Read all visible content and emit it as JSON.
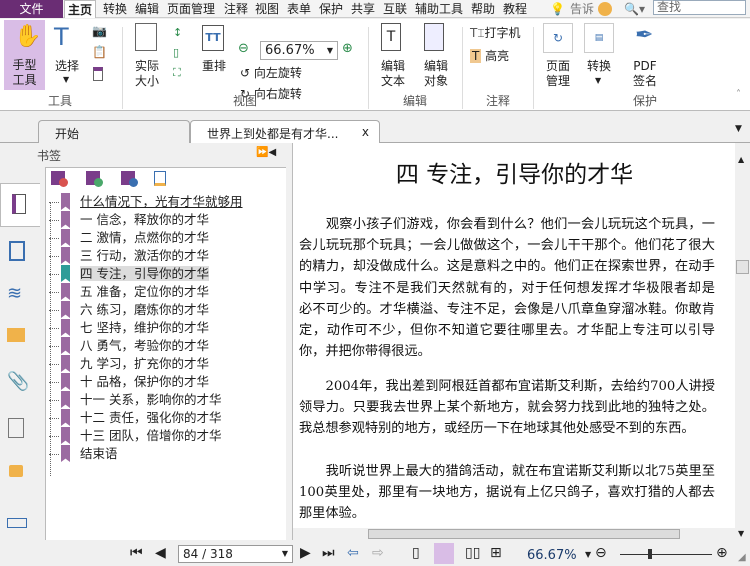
{
  "menubar": {
    "file": "文件",
    "items": [
      "主页",
      "转换",
      "编辑",
      "页面管理",
      "注释",
      "视图",
      "表单",
      "保护",
      "共享",
      "互联",
      "辅助工具",
      "帮助",
      "教程"
    ],
    "tell": "告诉",
    "search_placeholder": "查找"
  },
  "ribbon": {
    "hand": "手型\n工具",
    "select": "选择",
    "tools_group": "工具",
    "actual": "实际\n大小",
    "reflow": "重排",
    "zoom": "66.67%",
    "rotate_left": "向左旋转",
    "rotate_right": "向右旋转",
    "view_group": "视图",
    "edit_text": "编辑\n文本",
    "edit_object": "编辑\n对象",
    "edit_group": "编辑",
    "typewriter": "打字机",
    "highlight": "高亮",
    "comment_group": "注释",
    "page_manage": "页面\n管理",
    "convert": "转换",
    "pdf_sign": "PDF\n签名",
    "protect_group": "保护"
  },
  "tabs": [
    {
      "label": "开始"
    },
    {
      "label": "世界上到处都是有才华...",
      "close": "x"
    }
  ],
  "bookmarks": {
    "title": "书签",
    "items": [
      "什么情况下，光有才华就够用",
      "一 信念，释放你的才华",
      "二 激情，点燃你的才华",
      "三 行动，激活你的才华",
      "四 专注，引导你的才华",
      "五 准备，定位你的才华",
      "六 练习，磨炼你的才华",
      "七 坚持，维护你的才华",
      "八 勇气，考验你的才华",
      "九 学习，扩充你的才华",
      "十 品格，保护你的才华",
      "十一 关系，影响你的才华",
      "十二 责任，强化你的才华",
      "十三 团队，倍增你的才华",
      "结束语"
    ],
    "selected_index": 4
  },
  "document": {
    "title": "四 专注，引导你的才华",
    "paragraphs": [
      [
        "　　观察小孩子们游戏，你会看到什么？他们一会儿玩玩这个玩具，一",
        "会儿玩玩那个玩具；一会儿做做这个，一会儿干干那个。他们花了很大",
        "的精力，却没做成什么。这是意料之中的。他们正在探索世界，在动手",
        "中学习。专注不是我们天然就有的，对于任何想发挥才华极限者却是",
        "必不可少的。才华横溢、专注不足，会像是八爪章鱼穿溜冰鞋。你敢肯",
        "定，动作可不少，但你不知道它要往哪里去。才华配上专注可以引导",
        "你，并把你带得很远。"
      ],
      [
        "　　2004年，我出差到阿根廷首都布宜诺斯艾利斯，去给约700人讲授",
        "领导力。只要我去世界上某个新地方，就会努力找到此地的独特之处。",
        "我总想参观特别的地方，或经历一下在地球其他处感受不到的东西。"
      ],
      [
        "　　我听说世界上最大的猎鸽活动，就在布宜诺斯艾利斯以北75英里至",
        "100英里处，那里有一块地方，据说有上亿只鸽子，喜欢打猎的人都去",
        "那里体验。"
      ]
    ]
  },
  "status": {
    "page": "84 / 318",
    "zoom": "66.67%",
    "zoom_slider_fraction": 0.33
  },
  "colors": {
    "accent": "#6a2d74",
    "bookmark": "#9b6aa1",
    "bookmark_selected": "#2e9c98",
    "hand_active": "#d9bde6"
  }
}
